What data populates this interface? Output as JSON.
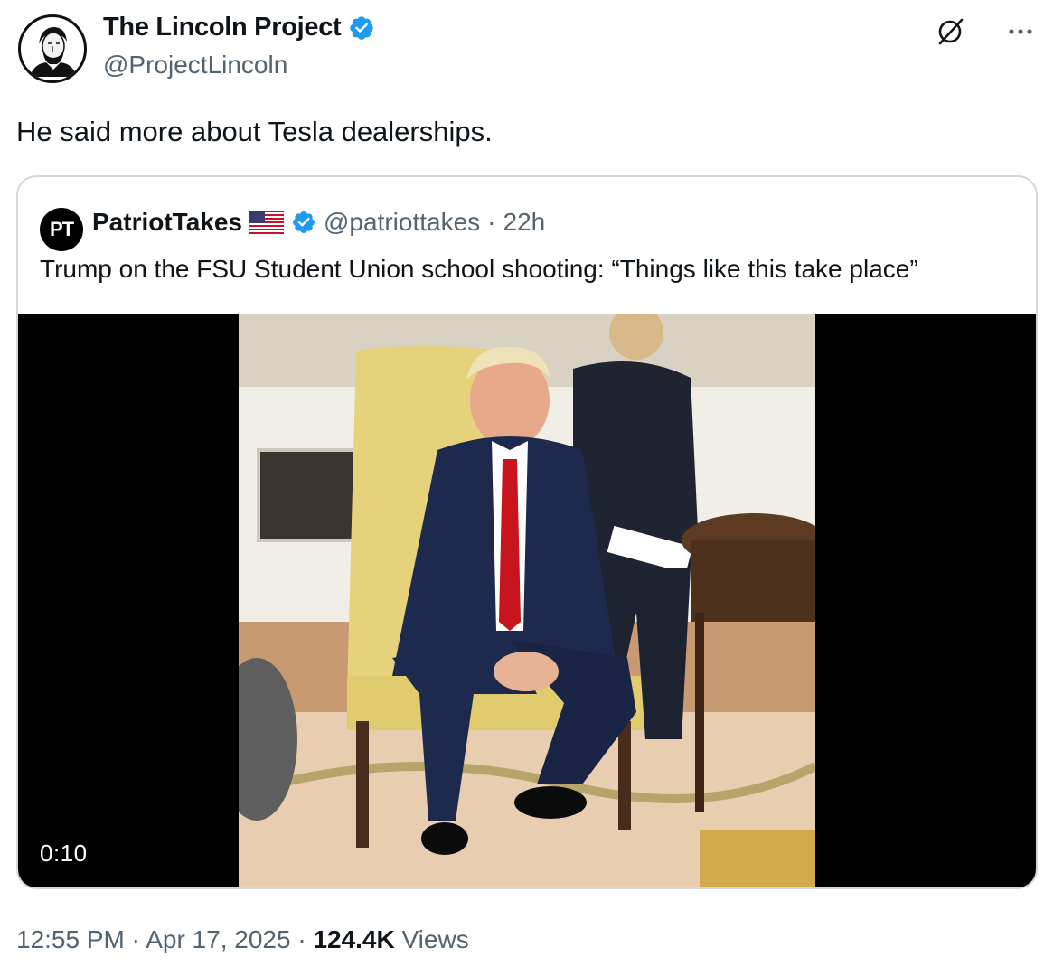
{
  "author": {
    "display_name": "The Lincoln Project",
    "handle": "@ProjectLincoln",
    "verified": true
  },
  "tweet_text": "He said more about Tesla dealerships.",
  "icons": {
    "grok": "grok-icon",
    "more": "more-icon",
    "verified": "verified-badge-icon"
  },
  "quote": {
    "avatar_initials": "PT",
    "display_name": "PatriotTakes",
    "flag": "us-flag-emoji",
    "handle": "@patriottakes",
    "separator": "·",
    "time": "22h",
    "text": "Trump on the FSU Student Union school shooting: “Things like this take place”",
    "video": {
      "duration": "0:10"
    }
  },
  "meta": {
    "time": "12:55 PM",
    "sep1": "·",
    "date": "Apr 17, 2025",
    "sep2": "·",
    "views_count": "124.4K",
    "views_label": "Views"
  },
  "colors": {
    "verified_blue": "#1d9bf0",
    "secondary_text": "#536471",
    "card_border": "#cfd9de"
  }
}
